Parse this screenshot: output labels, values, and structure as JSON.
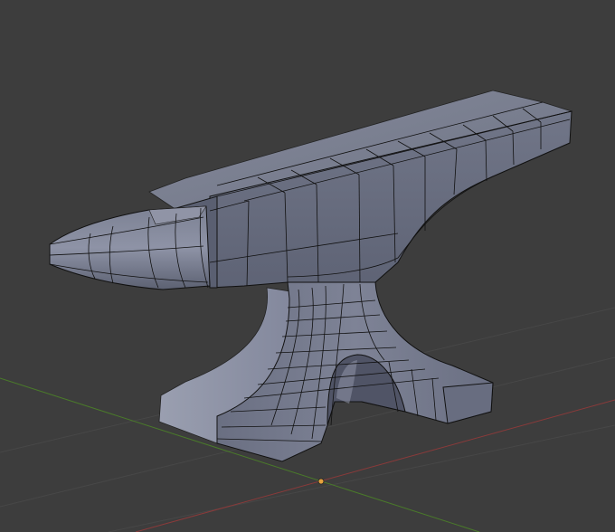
{
  "viewport": {
    "background": "#3d3d3d",
    "grid_color": "#474747",
    "x_axis_color": "#8a3a3a",
    "y_axis_color": "#4a7a2a",
    "mesh_face_color": "#73788a",
    "mesh_edge_color": "#111111",
    "origin_color": "#e6a23c",
    "object": "anvil-mesh",
    "mode": "edit-mode-wireframe-overlay"
  }
}
